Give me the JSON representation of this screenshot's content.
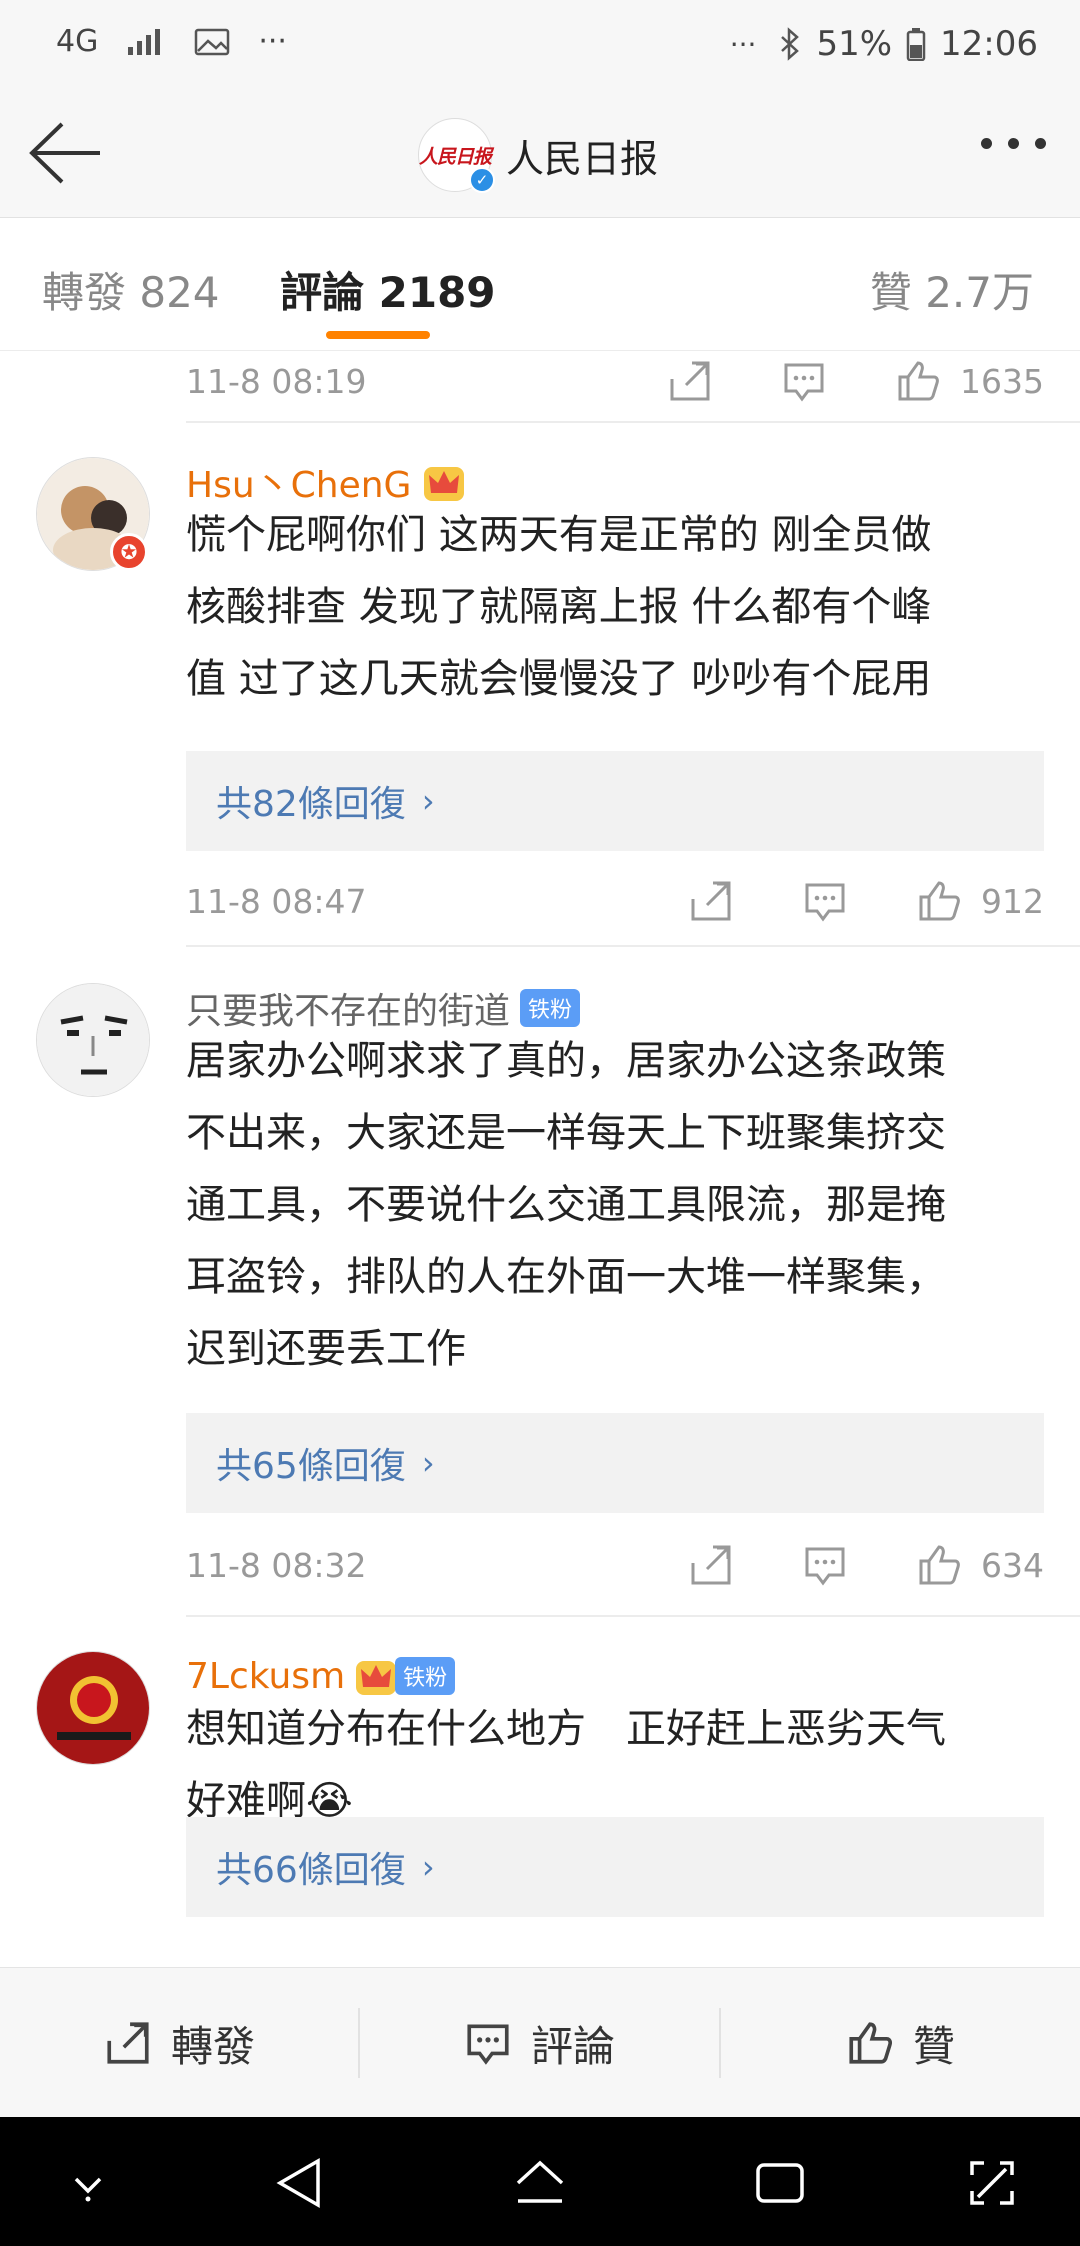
{
  "status_bar": {
    "network": "4G",
    "battery": "51%",
    "time": "12:06",
    "icons": [
      "signal-icon",
      "image-icon",
      "more-dots-icon",
      "bluetooth-icon",
      "battery-icon"
    ]
  },
  "header": {
    "account_name": "人民日报",
    "logo_text": "人民日报",
    "verified": true
  },
  "tabs": [
    {
      "label": "轉發 824"
    },
    {
      "label": "評論 2189",
      "active": true
    },
    {
      "label": "贊 2.7万"
    }
  ],
  "accent_color": "#ff8200",
  "top_meta": {
    "time": "11-8 08:19",
    "likes": "1635"
  },
  "comments": [
    {
      "username": "Hsu丶ChenG",
      "badge_fan": "",
      "text": [
        "慌个屁啊你们 这两天有是正常的 刚全员做",
        "核酸排查 发现了就隔离上报 什么都有个峰",
        "值 过了这几天就会慢慢没了 吵吵有个屁用"
      ],
      "replies": "共82條回復",
      "time": "11-8 08:47",
      "likes": "912"
    },
    {
      "username": "只要我不存在的街道",
      "badge_fan": "铁粉",
      "text": [
        "居家办公啊求求了真的，居家办公这条政策",
        "不出来，大家还是一样每天上下班聚集挤交",
        "通工具，不要说什么交通工具限流，那是掩",
        "耳盗铃，排队的人在外面一大堆一样聚集，",
        "迟到还要丢工作"
      ],
      "replies": "共65條回復",
      "time": "11-8 08:32",
      "likes": "634"
    },
    {
      "username": "7Lckusm",
      "badge_fan": "铁粉",
      "text": [
        "想知道分布在什么地方　正好赶上恶劣天气",
        "好难啊😭"
      ],
      "replies": "共66條回復"
    }
  ],
  "action_bar": {
    "repost": "轉發",
    "comment": "評論",
    "like": "贊"
  }
}
